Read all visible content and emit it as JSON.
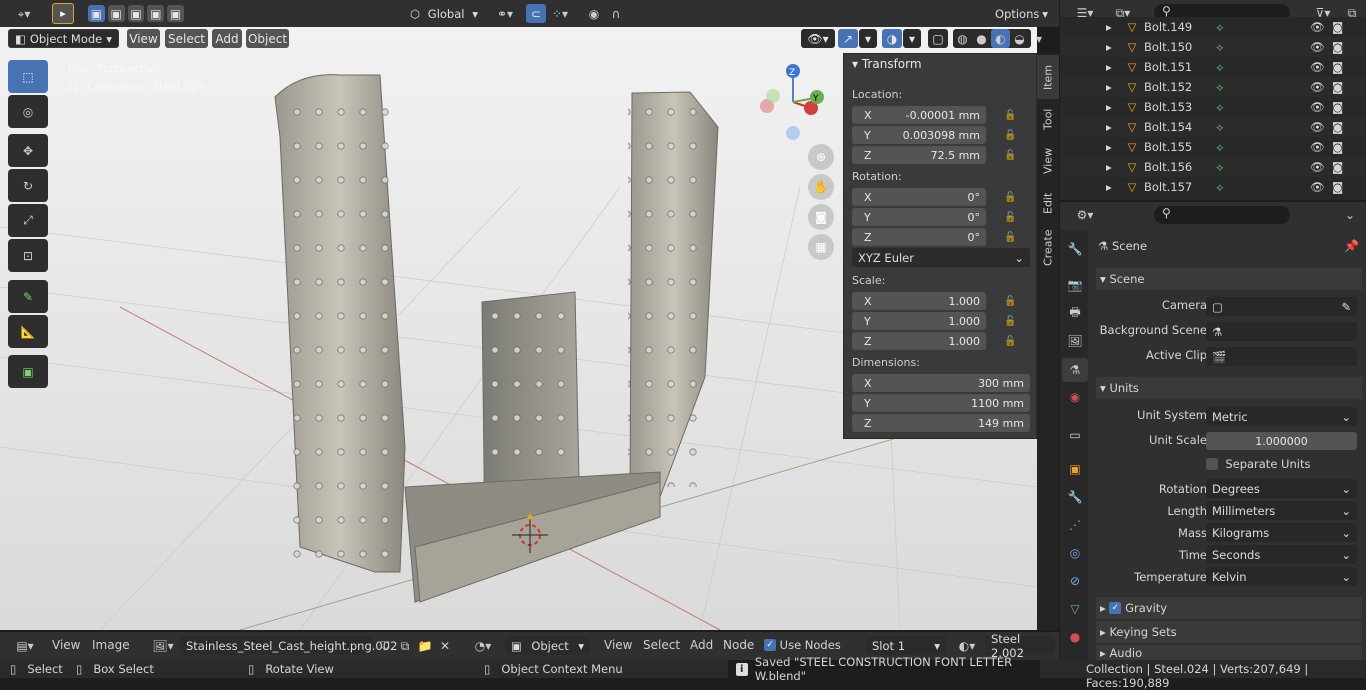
{
  "topbar": {
    "orientation": "Global",
    "options": "Options"
  },
  "viewport_header": {
    "mode": "Object Mode",
    "menus": [
      "View",
      "Select",
      "Add",
      "Object"
    ]
  },
  "overlay": {
    "perspective": "User Perspective",
    "collection": "(1) Collection | Steel.024"
  },
  "gizmo": {
    "z": "Z",
    "y": "Y"
  },
  "npanel": {
    "title": "Transform",
    "location_label": "Location:",
    "location": [
      {
        "axis": "X",
        "value": "-0.00001 mm"
      },
      {
        "axis": "Y",
        "value": "0.003098 mm"
      },
      {
        "axis": "Z",
        "value": "72.5 mm"
      }
    ],
    "rotation_label": "Rotation:",
    "rotation": [
      {
        "axis": "X",
        "value": "0°"
      },
      {
        "axis": "Y",
        "value": "0°"
      },
      {
        "axis": "Z",
        "value": "0°"
      }
    ],
    "rotation_mode": "XYZ Euler",
    "scale_label": "Scale:",
    "scale": [
      {
        "axis": "X",
        "value": "1.000"
      },
      {
        "axis": "Y",
        "value": "1.000"
      },
      {
        "axis": "Z",
        "value": "1.000"
      }
    ],
    "dimensions_label": "Dimensions:",
    "dimensions": [
      {
        "axis": "X",
        "value": "300 mm"
      },
      {
        "axis": "Y",
        "value": "1100 mm"
      },
      {
        "axis": "Z",
        "value": "149 mm"
      }
    ]
  },
  "sidetabs": [
    "Item",
    "Tool",
    "View",
    "Edit",
    "Create"
  ],
  "outliner": {
    "items": [
      "Bolt.149",
      "Bolt.150",
      "Bolt.151",
      "Bolt.152",
      "Bolt.153",
      "Bolt.154",
      "Bolt.155",
      "Bolt.156",
      "Bolt.157"
    ]
  },
  "properties": {
    "breadcrumb": "Scene",
    "scene_panel": "Scene",
    "camera_label": "Camera",
    "bg_scene_label": "Background Scene",
    "active_clip_label": "Active Clip",
    "units_panel": "Units",
    "unit_system_label": "Unit System",
    "unit_system": "Metric",
    "unit_scale_label": "Unit Scale",
    "unit_scale": "1.000000",
    "separate_units": "Separate Units",
    "rotation_label": "Rotation",
    "rotation": "Degrees",
    "length_label": "Length",
    "length": "Millimeters",
    "mass_label": "Mass",
    "mass": "Kilograms",
    "time_label": "Time",
    "time": "Seconds",
    "temperature_label": "Temperature",
    "temperature": "Kelvin",
    "gravity": "Gravity",
    "keying_sets": "Keying Sets",
    "audio": "Audio"
  },
  "bottombar": {
    "view": "View",
    "image": "Image",
    "image_name": "Stainless_Steel_Cast_height.png.002",
    "object": "Object",
    "menus": [
      "View",
      "Select",
      "Add",
      "Node"
    ],
    "use_nodes": "Use Nodes",
    "slot": "Slot 1",
    "material": "Steel 2.002"
  },
  "statusbar": {
    "select": "Select",
    "box_select": "Box Select",
    "rotate_view": "Rotate View",
    "context_menu": "Object Context Menu",
    "saved": "Saved \"STEEL CONSTRUCTION FONT LETTER W.blend\"",
    "stats": "Collection | Steel.024 | Verts:207,649 | Faces:190,889"
  }
}
